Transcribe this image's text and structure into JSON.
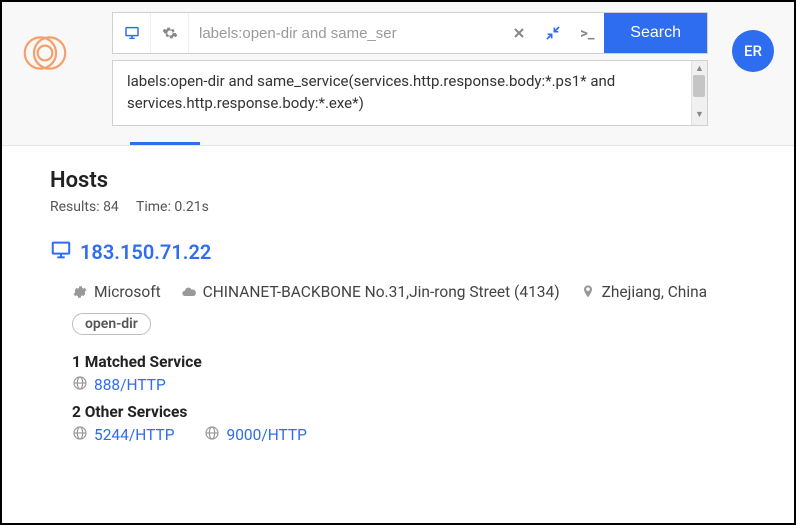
{
  "header": {
    "search_placeholder": "labels:open-dir and same_ser",
    "search_button": "Search",
    "query_text": "labels:open-dir and same_service(services.http.response.body:*.ps1* and services.http.response.body:*.exe*)"
  },
  "user": {
    "avatar_initials": "ER"
  },
  "results": {
    "section_title": "Hosts",
    "count_label": "Results: 84",
    "time_label": "Time: 0.21s"
  },
  "host": {
    "ip": "183.150.71.22",
    "os": "Microsoft",
    "asn": "CHINANET-BACKBONE No.31,Jin-rong Street (4134)",
    "location": "Zhejiang, China",
    "tag": "open-dir",
    "matched_header": "1 Matched Service",
    "matched_services": [
      {
        "label": "888/HTTP"
      }
    ],
    "other_header": "2 Other Services",
    "other_services": [
      {
        "label": "5244/HTTP"
      },
      {
        "label": "9000/HTTP"
      }
    ]
  }
}
